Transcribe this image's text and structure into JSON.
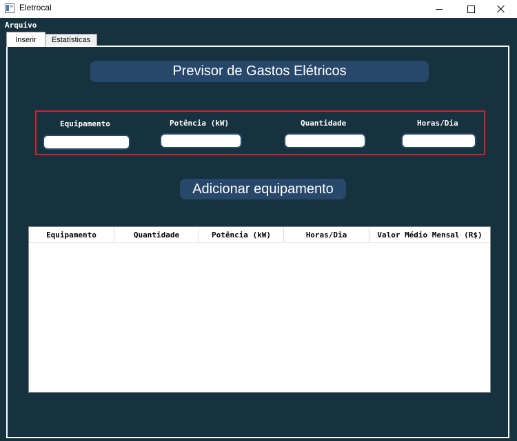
{
  "window": {
    "title": "Eletrocal"
  },
  "menu": {
    "arquivo": "Arquivo"
  },
  "tabs": [
    {
      "label": "Inserir"
    },
    {
      "label": "Estatísticas"
    }
  ],
  "header": {
    "title": "Previsor de Gastos Elétricos"
  },
  "form": {
    "fields": [
      {
        "label": "Equipamento",
        "value": ""
      },
      {
        "label": "Potência (kW)",
        "value": ""
      },
      {
        "label": "Quantidade",
        "value": ""
      },
      {
        "label": "Horas/Dia",
        "value": ""
      }
    ],
    "add_button": "Adicionar equipamento"
  },
  "table": {
    "columns": [
      "Equipamento",
      "Quantidade",
      "Potência (kW)",
      "Horas/Dia",
      "Valor Médio Mensal (R$)"
    ],
    "rows": []
  },
  "colors": {
    "background": "#17323f",
    "accent": "#27486a",
    "highlight_border": "#d81d2b"
  }
}
